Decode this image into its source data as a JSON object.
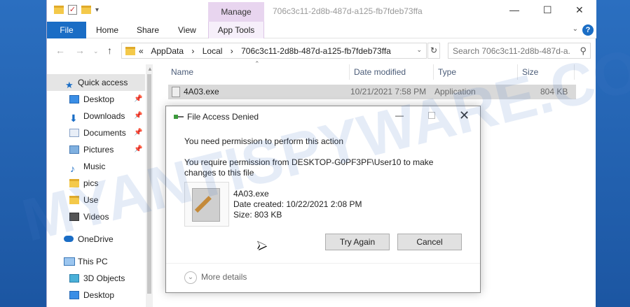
{
  "window": {
    "title": "706c3c11-2d8b-487d-a125-fb7fdeb73ffa",
    "manage_tab": "Manage",
    "controls": {
      "minimize": "—",
      "maximize": "☐",
      "close": "✕"
    }
  },
  "ribbon": {
    "tabs": [
      "File",
      "Home",
      "Share",
      "View",
      "App Tools"
    ],
    "help": "?"
  },
  "address": {
    "crumbs": [
      "«",
      "AppData",
      "›",
      "Local",
      "›",
      "706c3c11-2d8b-487d-a125-fb7fdeb73ffa"
    ],
    "search_placeholder": "Search 706c3c11-2d8b-487d-a..."
  },
  "sidebar": {
    "items": [
      {
        "label": "Quick access",
        "icon": "star-icon",
        "pinned": false,
        "selected": true
      },
      {
        "label": "Desktop",
        "icon": "desktop-icon",
        "pinned": true
      },
      {
        "label": "Downloads",
        "icon": "download-icon",
        "pinned": true
      },
      {
        "label": "Documents",
        "icon": "documents-icon",
        "pinned": true
      },
      {
        "label": "Pictures",
        "icon": "pictures-icon",
        "pinned": true
      },
      {
        "label": "Music",
        "icon": "music-icon",
        "pinned": false
      },
      {
        "label": "pics",
        "icon": "folder-icon",
        "pinned": false
      },
      {
        "label": "Use",
        "icon": "folder-icon",
        "pinned": false
      },
      {
        "label": "Videos",
        "icon": "videos-icon",
        "pinned": false
      },
      {
        "label": "OneDrive",
        "icon": "cloud-icon",
        "pinned": false
      },
      {
        "label": "This PC",
        "icon": "pc-icon",
        "pinned": false
      },
      {
        "label": "3D Objects",
        "icon": "cube-icon",
        "pinned": false
      },
      {
        "label": "Desktop",
        "icon": "desktop-icon",
        "pinned": false
      }
    ]
  },
  "filelist": {
    "columns": [
      "Name",
      "Date modified",
      "Type",
      "Size"
    ],
    "rows": [
      {
        "name": "4A03.exe",
        "date": "10/21/2021 7:58 PM",
        "type": "Application",
        "size": "804 KB"
      }
    ]
  },
  "dialog": {
    "title": "File Access Denied",
    "message1": "You need permission to perform this action",
    "message2": "You require permission from DESKTOP-G0PF3PF\\User10 to make changes to this file",
    "file": {
      "name": "4A03.exe",
      "date_created": "Date created: 10/22/2021 2:08 PM",
      "size": "Size: 803 KB"
    },
    "try_again": "Try Again",
    "cancel": "Cancel",
    "more_details": "More details",
    "controls": {
      "minimize": "—",
      "close": "✕"
    }
  },
  "watermark": "MYANTISPYWARE.COM",
  "colors": {
    "accent": "#1a6dc5",
    "manage": "#e8d5ef",
    "selection": "#d9d9d9"
  }
}
